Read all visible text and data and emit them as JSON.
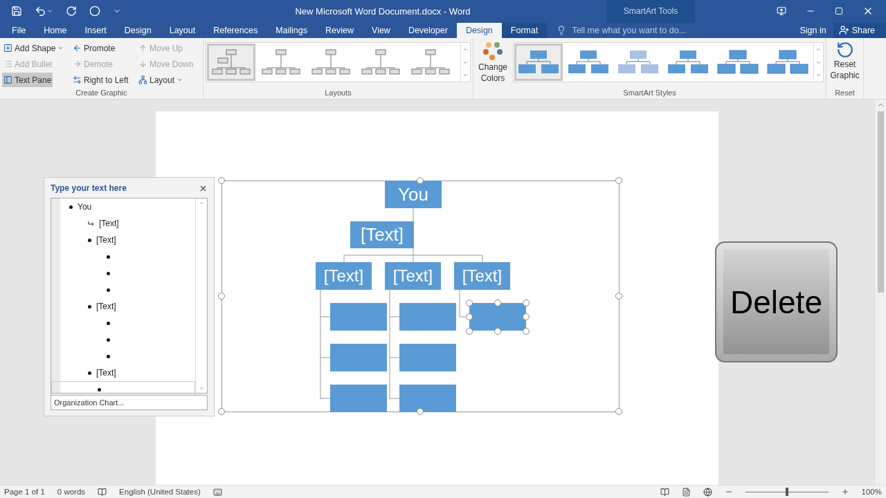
{
  "window": {
    "title": "New Microsoft Word Document.docx - Word",
    "context_label": "SmartArt Tools"
  },
  "tabs": [
    {
      "label": "File",
      "selected": false,
      "contextual": false
    },
    {
      "label": "Home",
      "selected": false,
      "contextual": false
    },
    {
      "label": "Insert",
      "selected": false,
      "contextual": false
    },
    {
      "label": "Design",
      "selected": false,
      "contextual": false
    },
    {
      "label": "Layout",
      "selected": false,
      "contextual": false
    },
    {
      "label": "References",
      "selected": false,
      "contextual": false
    },
    {
      "label": "Mailings",
      "selected": false,
      "contextual": false
    },
    {
      "label": "Review",
      "selected": false,
      "contextual": false
    },
    {
      "label": "View",
      "selected": false,
      "contextual": false
    },
    {
      "label": "Developer",
      "selected": false,
      "contextual": false
    },
    {
      "label": "Design",
      "selected": true,
      "contextual": true
    },
    {
      "label": "Format",
      "selected": false,
      "contextual": true
    }
  ],
  "tell_me": {
    "placeholder": "Tell me what you want to do..."
  },
  "account": {
    "sign_in": "Sign in",
    "share": "Share"
  },
  "ribbon": {
    "create_graphic": {
      "label": "Create Graphic",
      "buttons": [
        {
          "kind": "add-shape",
          "label": "Add Shape",
          "disabled": false,
          "on": false
        },
        {
          "kind": "promote",
          "label": "Promote",
          "disabled": false,
          "on": false
        },
        {
          "kind": "move-up",
          "label": "Move Up",
          "disabled": true,
          "on": false
        },
        {
          "kind": "add-bullet",
          "label": "Add Bullet",
          "disabled": true,
          "on": false
        },
        {
          "kind": "demote",
          "label": "Demote",
          "disabled": true,
          "on": false
        },
        {
          "kind": "move-down",
          "label": "Move Down",
          "disabled": true,
          "on": false
        },
        {
          "kind": "text-pane",
          "label": "Text Pane",
          "disabled": false,
          "on": true
        },
        {
          "kind": "right-to-left",
          "label": "Right to Left",
          "disabled": false,
          "on": false
        },
        {
          "kind": "layout",
          "label": "Layout",
          "disabled": false,
          "on": false
        }
      ]
    },
    "layouts": {
      "label": "Layouts",
      "items": [
        {
          "selected": true
        },
        {
          "selected": false
        },
        {
          "selected": false
        },
        {
          "selected": false
        },
        {
          "selected": false
        }
      ]
    },
    "change_colors": {
      "label": "Change Colors"
    },
    "styles": {
      "label": "SmartArt Styles",
      "items": [
        {
          "selected": true
        },
        {
          "selected": false
        },
        {
          "selected": false
        },
        {
          "selected": false
        },
        {
          "selected": false
        },
        {
          "selected": false
        }
      ]
    },
    "reset": {
      "label": "Reset",
      "button": "Reset Graphic"
    }
  },
  "text_pane": {
    "title": "Type your text here",
    "items": [
      {
        "kind": "bullet",
        "text": "You",
        "selected": false,
        "children": [
          {
            "kind": "assistant",
            "text": "[Text]",
            "selected": false
          },
          {
            "kind": "bullet",
            "text": "[Text]",
            "selected": false,
            "children": [
              {
                "kind": "bullet",
                "selected": false
              },
              {
                "kind": "bullet",
                "selected": false
              },
              {
                "kind": "bullet",
                "selected": false
              }
            ]
          },
          {
            "kind": "bullet",
            "text": "[Text]",
            "selected": false,
            "children": [
              {
                "kind": "bullet",
                "selected": false
              },
              {
                "kind": "bullet",
                "selected": false
              },
              {
                "kind": "bullet",
                "selected": false
              }
            ]
          },
          {
            "kind": "bullet",
            "text": "[Text]",
            "selected": false,
            "children": [
              {
                "kind": "bullet",
                "selected": true
              }
            ]
          }
        ]
      }
    ],
    "footer": "Organization Chart..."
  },
  "org_chart": {
    "root": "You",
    "assistant": "[Text]",
    "branches": [
      {
        "text": "[Text]",
        "children": [
          {
            "selected": false
          },
          {
            "selected": false
          },
          {
            "selected": false
          }
        ]
      },
      {
        "text": "[Text]",
        "children": [
          {
            "selected": false
          },
          {
            "selected": false
          },
          {
            "selected": false
          }
        ]
      },
      {
        "text": "[Text]",
        "children": [
          {
            "selected": true
          }
        ]
      }
    ]
  },
  "key_overlay": {
    "label": "Delete"
  },
  "status_bar": {
    "page": "Page 1 of 1",
    "words": "0 words",
    "language": "English (United States)",
    "zoom": "100%",
    "zoom_level": {
      "level": 0.5
    }
  }
}
